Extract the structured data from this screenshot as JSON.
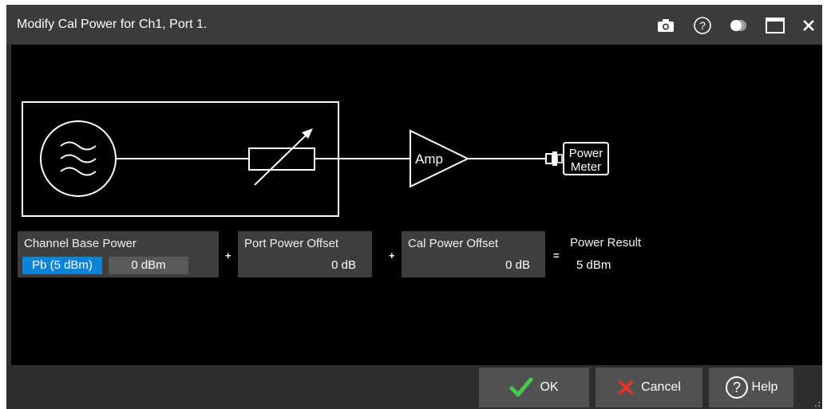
{
  "dialog": {
    "title": "Modify Cal Power for Ch1, Port 1."
  },
  "titlebar_icons": [
    "camera-icon",
    "help-icon",
    "toggle-icon",
    "maximize-icon",
    "close-icon"
  ],
  "diagram": {
    "amp_label": "Amp",
    "power_meter_line1": "Power",
    "power_meter_line2": "Meter"
  },
  "fields": {
    "channel_base_power": {
      "label": "Channel Base Power",
      "pb_button": "Pb (5 dBm)",
      "value": "0 dBm"
    },
    "op1": "+",
    "port_power_offset": {
      "label": "Port Power Offset",
      "value": "0 dB"
    },
    "op2": "+",
    "cal_power_offset": {
      "label": "Cal Power Offset",
      "value": "0 dB"
    },
    "op3": "=",
    "power_result": {
      "label": "Power Result",
      "value": "5 dBm"
    }
  },
  "buttons": {
    "ok": "OK",
    "cancel": "Cancel",
    "help": "Help"
  },
  "colors": {
    "accent": "#0a84d8",
    "ok_check": "#48c84a",
    "cancel_x": "#e8332a"
  }
}
